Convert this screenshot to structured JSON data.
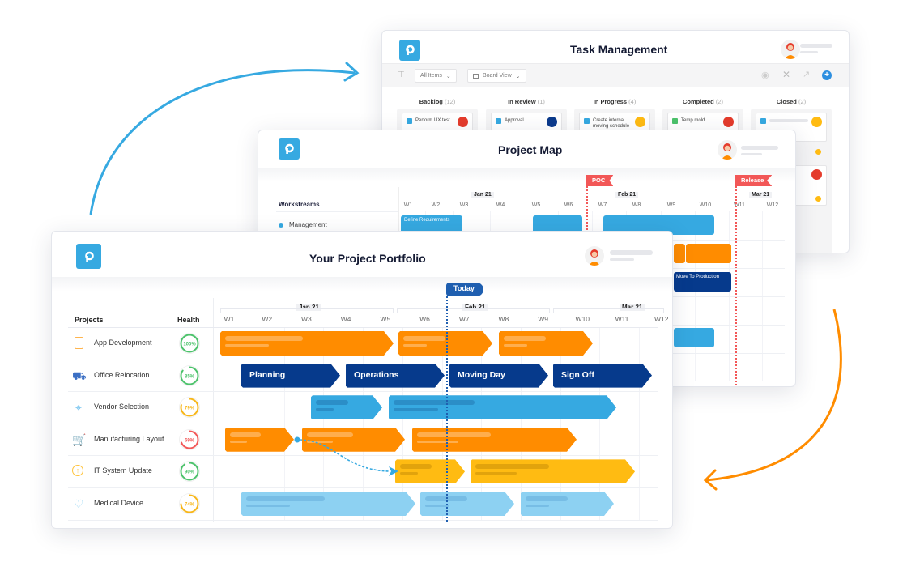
{
  "task_management": {
    "title": "Task Management",
    "toolbar": {
      "filter_icon": "filter-icon",
      "items_dropdown": "All Items",
      "view_dropdown": "Board View",
      "icons": [
        "eye-icon",
        "tools-icon",
        "share-icon",
        "add-icon"
      ]
    },
    "columns": [
      {
        "name": "Backlog",
        "count": "(12)",
        "card": "Perform UX test"
      },
      {
        "name": "In Review",
        "count": "(1)",
        "card": "Approval"
      },
      {
        "name": "In Progress",
        "count": "(4)",
        "card": "Create internal moving schedule"
      },
      {
        "name": "Completed",
        "count": "(2)",
        "card": "Temp mold"
      },
      {
        "name": "Closed",
        "count": "(2)",
        "card": ""
      }
    ]
  },
  "project_map": {
    "title": "Project Map",
    "workstreams_header": "Workstreams",
    "workstreams": [
      "Management"
    ],
    "months": [
      "Jan 21",
      "Feb 21",
      "Mar 21"
    ],
    "weeks": [
      "W1",
      "W2",
      "W3",
      "W4",
      "W5",
      "W6",
      "W7",
      "W8",
      "W9",
      "W10",
      "W11",
      "W12"
    ],
    "milestones": [
      "POC",
      "Release"
    ],
    "tasks": [
      "Define Requirements",
      "Move To Production"
    ]
  },
  "portfolio": {
    "title": "Your Project Portfolio",
    "projects_header": "Projects",
    "health_header": "Health",
    "today_label": "Today",
    "months": [
      "Jan 21",
      "Feb 21",
      "Mar 21"
    ],
    "weeks": [
      "W1",
      "W2",
      "W3",
      "W4",
      "W5",
      "W6",
      "W7",
      "W8",
      "W9",
      "W10",
      "W11",
      "W12"
    ],
    "projects": [
      {
        "name": "App Development",
        "icon": "tablet-icon",
        "health": "100%",
        "health_value": 100,
        "health_color": "#4cc26b"
      },
      {
        "name": "Office Relocation",
        "icon": "truck-icon",
        "health": "85%",
        "health_value": 85,
        "health_color": "#4cc26b"
      },
      {
        "name": "Vendor Selection",
        "icon": "location-pin-icon",
        "health": "79%",
        "health_value": 79,
        "health_color": "#f7b619"
      },
      {
        "name": "Manufacturing Layout",
        "icon": "cart-icon",
        "health": "69%",
        "health_value": 69,
        "health_color": "#f25757"
      },
      {
        "name": "IT System Update",
        "icon": "upload-circle-icon",
        "health": "90%",
        "health_value": 90,
        "health_color": "#4cc26b"
      },
      {
        "name": "Medical Device",
        "icon": "heartbeat-icon",
        "health": "74%",
        "health_value": 74,
        "health_color": "#f7b619"
      }
    ],
    "office_relocation_phases": [
      "Planning",
      "Operations",
      "Moving Day",
      "Sign Off"
    ]
  },
  "colors": {
    "brand_blue": "#36a9e1",
    "navy": "#063a8c",
    "orange": "#ff8c00",
    "yellow": "#ffbb12",
    "light_blue": "#8dd1f2",
    "milestone_red": "#f25757"
  }
}
